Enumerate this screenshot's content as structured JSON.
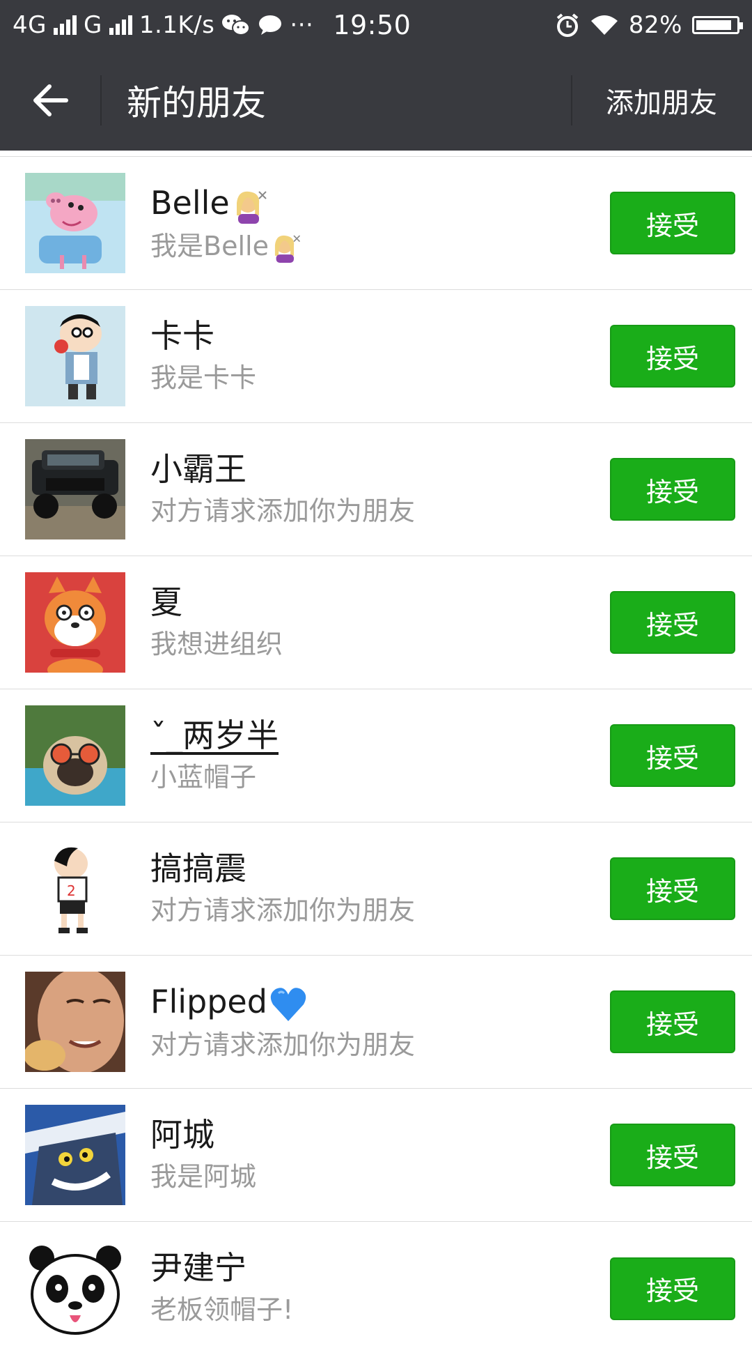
{
  "status_bar": {
    "network_1": "4G",
    "network_2": "G",
    "speed": "1.1K/s",
    "more": "···",
    "time": "19:50",
    "battery": "82%",
    "battery_level": 0.82
  },
  "header": {
    "title": "新的朋友",
    "add_friend": "添加朋友",
    "back_icon": "back-arrow-icon"
  },
  "colors": {
    "bar_bg": "#393a3f",
    "accept_green": "#1aad19",
    "secondary_text": "#9a9a9a"
  },
  "requests": [
    {
      "name": "Belle",
      "name_emoji": "hairdresser-emoji",
      "message": "我是Belle",
      "message_emoji": "hairdresser-emoji",
      "accept": "接受",
      "avatar": "peppa-pig-avatar"
    },
    {
      "name": "卡卡",
      "message": "我是卡卡",
      "accept": "接受",
      "avatar": "cartoon-boy-avatar"
    },
    {
      "name": "小霸王",
      "message": "对方请求添加你为朋友",
      "accept": "接受",
      "avatar": "pickup-truck-avatar"
    },
    {
      "name": "夏",
      "message": "我想进组织",
      "accept": "接受",
      "avatar": "shiba-dog-avatar"
    },
    {
      "name": "ˇ_两岁半",
      "message": "小蓝帽子",
      "accept": "接受",
      "avatar": "pug-sunglasses-avatar"
    },
    {
      "name": "搞搞震",
      "message": "对方请求添加你为朋友",
      "accept": "接受",
      "avatar": "cartoon-kid-avatar"
    },
    {
      "name": "Flipped",
      "name_emoji": "blue-heart-emoji",
      "message": "对方请求添加你为朋友",
      "accept": "接受",
      "avatar": "girl-photo-avatar"
    },
    {
      "name": "阿城",
      "message": "我是阿城",
      "accept": "接受",
      "avatar": "tom-cat-avatar"
    },
    {
      "name": "尹建宁",
      "message": "老板领帽子!",
      "accept": "接受",
      "avatar": "panda-avatar"
    }
  ]
}
